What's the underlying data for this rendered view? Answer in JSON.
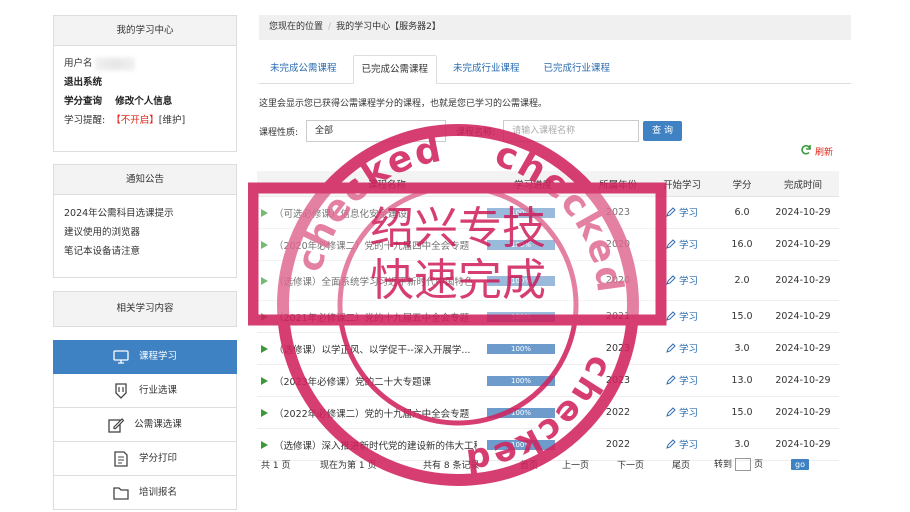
{
  "sidebar": {
    "user_panel": {
      "title": "我的学习中心",
      "username_label": "用户名",
      "logout": "退出系统",
      "credit_query": "学分查询",
      "edit_info": "修改个人信息",
      "reminder_label": "学习提醒:",
      "reminder_status": "【不开启】",
      "reminder_maintain": "[维护]"
    },
    "notice_panel": {
      "title": "通知公告",
      "items": [
        "2024年公需科目选课提示",
        "建议使用的浏览器",
        "笔记本设备请注意"
      ]
    },
    "related_panel": {
      "title": "相关学习内容"
    },
    "menu": [
      {
        "label": "课程学习",
        "icon": "monitor-icon",
        "active": true
      },
      {
        "label": "行业选课",
        "icon": "shield-icon",
        "active": false
      },
      {
        "label": "公需课选课",
        "icon": "edit-icon",
        "active": false
      },
      {
        "label": "学分打印",
        "icon": "document-icon",
        "active": false
      },
      {
        "label": "培训报名",
        "icon": "folder-icon",
        "active": false
      }
    ]
  },
  "breadcrumb": {
    "prefix": "您现在的位置",
    "sep": "/",
    "current": "我的学习中心【服务器2】"
  },
  "tabs": [
    {
      "label": "未完成公需课程",
      "active": false
    },
    {
      "label": "已完成公需课程",
      "active": true
    },
    {
      "label": "未完成行业课程",
      "active": false
    },
    {
      "label": "已完成行业课程",
      "active": false
    }
  ],
  "description": "这里会显示您已获得公需课程学分的课程，也就是您已学习的公需课程。",
  "filter": {
    "type_label": "课程性质:",
    "type_value": "全部",
    "name_label": "课程名称:",
    "name_placeholder": "请输入课程名称",
    "query_button": "查 询"
  },
  "refresh_label": "刷新",
  "table": {
    "headers": [
      "课程名称",
      "学习进度",
      "所属年份",
      "开始学习",
      "学分",
      "完成时间"
    ],
    "rows": [
      {
        "name": "（可选必修课）信息化安全建设",
        "progress": "100%",
        "year": "2023",
        "action": "学习",
        "credit": "6.0",
        "time": "2024-10-29"
      },
      {
        "name": "（2020年必修课二）党的十九届四中全会专题",
        "progress": "100%",
        "year": "2020",
        "action": "学习",
        "credit": "16.0",
        "time": "2024-10-29"
      },
      {
        "name": "（选修课）全面系统学习习近平新时代中国特色",
        "progress": "100%",
        "year": "2020",
        "action": "学习",
        "credit": "2.0",
        "time": "2024-10-29"
      },
      {
        "name": "（2021年必修课二）党的十九届五中全会专题",
        "progress": "100%",
        "year": "2021",
        "action": "学习",
        "credit": "15.0",
        "time": "2024-10-29"
      },
      {
        "name": "（选修课）以学正风、以学促干--深入开展学...",
        "progress": "100%",
        "year": "2023",
        "action": "学习",
        "credit": "3.0",
        "time": "2024-10-29"
      },
      {
        "name": "（2023年必修课）党的二十大专题课",
        "progress": "100%",
        "year": "2023",
        "action": "学习",
        "credit": "13.0",
        "time": "2024-10-29"
      },
      {
        "name": "（2022年必修课二）党的十九届六中全会专题",
        "progress": "100%",
        "year": "2022",
        "action": "学习",
        "credit": "15.0",
        "time": "2024-10-29"
      },
      {
        "name": "（选修课）深入推进新时代党的建设新的伟大工程",
        "progress": "100%",
        "year": "2022",
        "action": "学习",
        "credit": "3.0",
        "time": "2024-10-29"
      }
    ]
  },
  "pager": {
    "total_pages": "共 1 页",
    "current_page": "现在为第 1 页",
    "total_records": "共有 8 条记录",
    "first": "首页",
    "prev": "上一页",
    "next": "下一页",
    "last": "尾页",
    "goto_label": "转到",
    "page_unit": "页",
    "go": "go"
  },
  "stamp": {
    "line1": "绍兴专技",
    "line2": "快速完成",
    "ring_text": "checked",
    "color": "#d1245f"
  }
}
